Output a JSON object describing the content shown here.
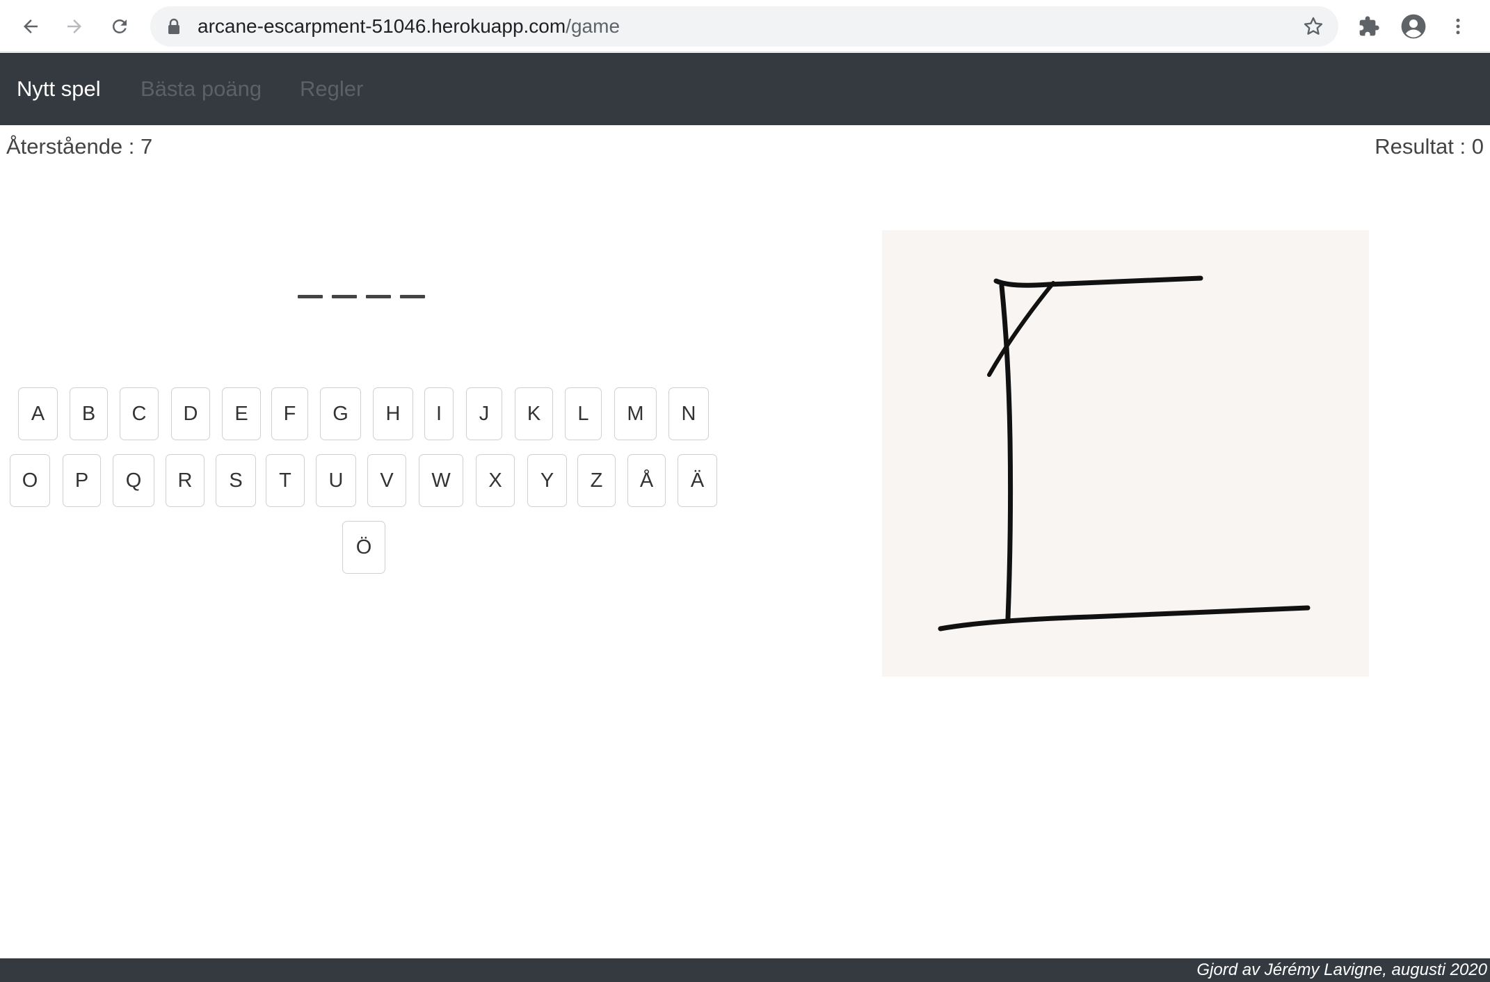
{
  "browser": {
    "url_host": "arcane-escarpment-51046.herokuapp.com",
    "url_path": "/game"
  },
  "navbar": {
    "items": [
      {
        "label": "Nytt spel",
        "active": true
      },
      {
        "label": "Bästa poäng",
        "active": false
      },
      {
        "label": "Regler",
        "active": false
      }
    ]
  },
  "status": {
    "remaining": "Återstående : 7",
    "score": "Resultat : 0"
  },
  "word": {
    "blank_count": 4
  },
  "keyboard": {
    "row1": [
      "A",
      "B",
      "C",
      "D",
      "E",
      "F",
      "G",
      "H",
      "I",
      "J",
      "K",
      "L",
      "M",
      "N"
    ],
    "row2": [
      "O",
      "P",
      "Q",
      "R",
      "S",
      "T",
      "U",
      "V",
      "W",
      "X",
      "Y",
      "Z",
      "Å",
      "Ä"
    ],
    "row3": [
      "Ö"
    ]
  },
  "footer": {
    "credit": "Gjord av Jérémy Lavigne, augusti 2020"
  },
  "colors": {
    "navbar_bg": "#343a40",
    "image_bg": "#f8f5f3"
  }
}
